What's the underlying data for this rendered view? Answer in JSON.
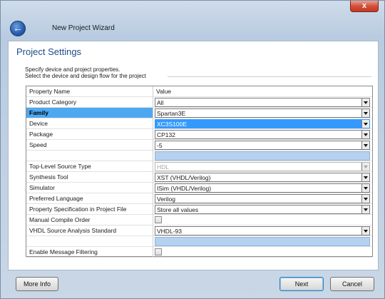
{
  "window": {
    "title": "New Project Wizard",
    "close_label": "x",
    "back_label": "←"
  },
  "page": {
    "title": "Project Settings",
    "desc_line1": "Specify device and project properties.",
    "desc_line2": "Select the device and design flow for the project"
  },
  "grid": {
    "header": {
      "name": "Property Name",
      "value": "Value"
    },
    "rows": [
      {
        "name": "Product Category",
        "value": "All"
      },
      {
        "name": "Family",
        "value": "Spartan3E"
      },
      {
        "name": "Device",
        "value": "XC3S100E"
      },
      {
        "name": "Package",
        "value": "CP132"
      },
      {
        "name": "Speed",
        "value": "-5"
      },
      {
        "name": "",
        "value": ""
      },
      {
        "name": "Top-Level Source Type",
        "value": "HDL"
      },
      {
        "name": "Synthesis Tool",
        "value": "XST (VHDL/Verilog)"
      },
      {
        "name": "Simulator",
        "value": "ISim (VHDL/Verilog)"
      },
      {
        "name": "Preferred Language",
        "value": "Verilog"
      },
      {
        "name": "Property Specification in Project File",
        "value": "Store all values"
      },
      {
        "name": "Manual Compile Order",
        "value": ""
      },
      {
        "name": "VHDL Source Analysis Standard",
        "value": "VHDL-93"
      },
      {
        "name": "",
        "value": ""
      },
      {
        "name": "Enable Message Filtering",
        "value": ""
      }
    ]
  },
  "buttons": {
    "more_info": "More Info",
    "next": "Next",
    "cancel": "Cancel"
  },
  "colors": {
    "selection": "#3399ff",
    "family_highlight": "#4ea8f0",
    "section_title": "#1f4a8a"
  }
}
